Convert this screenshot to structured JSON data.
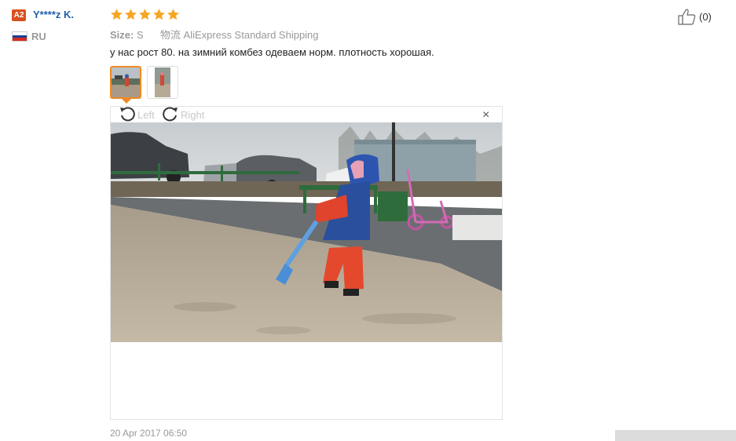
{
  "user": {
    "level_badge": "A2",
    "name": "Y****z K.",
    "country_code": "RU"
  },
  "review": {
    "rating": 5,
    "size_label": "Size:",
    "size_value": "S",
    "shipping_label": "物流",
    "shipping_value": "AliExpress Standard Shipping",
    "text": "у нас рост 80. на зимний комбез одеваем норм. плотность хорошая.",
    "date": "20 Apr 2017 06:50"
  },
  "helpful": {
    "count": "(0)"
  },
  "viewer": {
    "rotate_left": "Left",
    "rotate_right": "Right",
    "close": "×"
  },
  "colors": {
    "star": "#f5a623",
    "user_link": "#1f5fa8",
    "badge": "#d9501f",
    "active_thumb": "#f08a24"
  },
  "icons": [
    "star-icon",
    "thumbs-up-icon",
    "rotate-left-icon",
    "rotate-right-icon",
    "close-icon",
    "russia-flag-icon"
  ]
}
